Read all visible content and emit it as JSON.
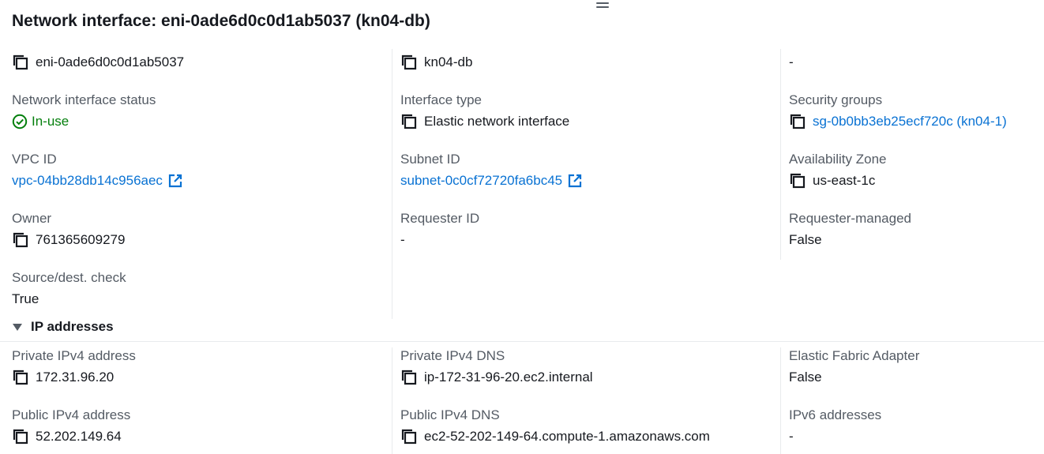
{
  "title": "Network interface: eni-0ade6d0c0d1ab5037 (kn04-db)",
  "summary": {
    "interface_id": "eni-0ade6d0c0d1ab5037",
    "name": "kn04-db",
    "description": "-"
  },
  "details": {
    "status_label": "Network interface status",
    "status_value": "In-use",
    "interface_type_label": "Interface type",
    "interface_type_value": "Elastic network interface",
    "security_groups_label": "Security groups",
    "security_groups_value": "sg-0b0bb3eb25ecf720c (kn04-1)",
    "vpc_label": "VPC ID",
    "vpc_value": "vpc-04bb28db14c956aec",
    "subnet_label": "Subnet ID",
    "subnet_value": "subnet-0c0cf72720fa6bc45",
    "az_label": "Availability Zone",
    "az_value": "us-east-1c",
    "owner_label": "Owner",
    "owner_value": "761365609279",
    "requester_label": "Requester ID",
    "requester_value": "-",
    "requester_managed_label": "Requester-managed",
    "requester_managed_value": "False",
    "source_dest_label": "Source/dest. check",
    "source_dest_value": "True"
  },
  "ip_section": {
    "header": "IP addresses",
    "private_ipv4_label": "Private IPv4 address",
    "private_ipv4_value": "172.31.96.20",
    "private_dns_label": "Private IPv4 DNS",
    "private_dns_value": "ip-172-31-96-20.ec2.internal",
    "efa_label": "Elastic Fabric Adapter",
    "efa_value": "False",
    "public_ipv4_label": "Public IPv4 address",
    "public_ipv4_value": "52.202.149.64",
    "public_dns_label": "Public IPv4 DNS",
    "public_dns_value": "ec2-52-202-149-64.compute-1.amazonaws.com",
    "ipv6_label": "IPv6 addresses",
    "ipv6_value": "-"
  },
  "icons": {
    "copy": "copy-icon",
    "external": "external-link-icon",
    "status": "check-circle-icon",
    "caret": "caret-down-icon",
    "handle": "drag-handle-icon"
  },
  "colors": {
    "link": "#0972d3",
    "success": "#037f0c",
    "label": "#545b64",
    "text": "#16191f"
  }
}
